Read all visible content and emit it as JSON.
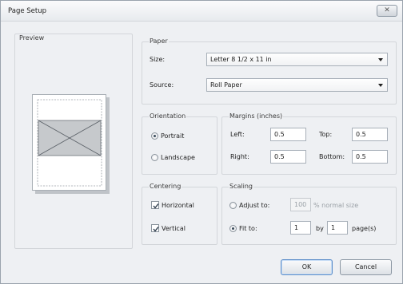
{
  "window": {
    "title": "Page Setup",
    "close": "✕"
  },
  "preview": {
    "label": "Preview"
  },
  "paper": {
    "label": "Paper",
    "size_label": "Size:",
    "size_value": "Letter 8 1/2 x 11 in",
    "source_label": "Source:",
    "source_value": "Roll Paper"
  },
  "orientation": {
    "label": "Orientation",
    "portrait": "Portrait",
    "landscape": "Landscape",
    "selected": "Portrait"
  },
  "margins": {
    "label": "Margins (inches)",
    "left_label": "Left:",
    "left_value": "0.5",
    "top_label": "Top:",
    "top_value": "0.5",
    "right_label": "Right:",
    "right_value": "0.5",
    "bottom_label": "Bottom:",
    "bottom_value": "0.5"
  },
  "centering": {
    "label": "Centering",
    "horizontal": "Horizontal",
    "vertical": "Vertical",
    "horizontal_checked": true,
    "vertical_checked": true
  },
  "scaling": {
    "label": "Scaling",
    "adjust_label": "Adjust to:",
    "adjust_value": "100",
    "adjust_suffix": "% normal size",
    "fit_label": "Fit to:",
    "fit_wide": "1",
    "by_label": "by",
    "fit_tall": "1",
    "pages_label": "page(s)",
    "selected": "Fit to:"
  },
  "buttons": {
    "ok": "OK",
    "cancel": "Cancel"
  }
}
